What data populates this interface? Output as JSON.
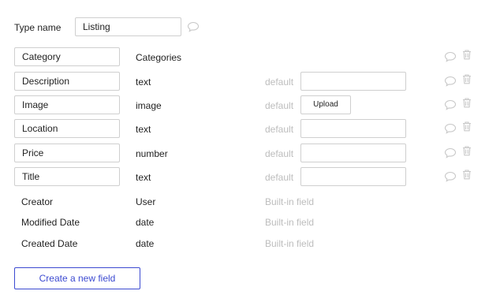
{
  "type_name": {
    "label": "Type name",
    "value": "Listing"
  },
  "fields": [
    {
      "name": "Category",
      "type": "Categories",
      "has_default": false
    },
    {
      "name": "Description",
      "type": "text",
      "has_default": true,
      "default_label": "default",
      "default_control": "input"
    },
    {
      "name": "Image",
      "type": "image",
      "has_default": true,
      "default_label": "default",
      "default_control": "upload",
      "upload_label": "Upload"
    },
    {
      "name": "Location",
      "type": "text",
      "has_default": true,
      "default_label": "default",
      "default_control": "input"
    },
    {
      "name": "Price",
      "type": "number",
      "has_default": true,
      "default_label": "default",
      "default_control": "input"
    },
    {
      "name": "Title",
      "type": "text",
      "has_default": true,
      "default_label": "default",
      "default_control": "input"
    }
  ],
  "builtin_fields": [
    {
      "name": "Creator",
      "type": "User",
      "note": "Built-in field"
    },
    {
      "name": "Modified Date",
      "type": "date",
      "note": "Built-in field"
    },
    {
      "name": "Created Date",
      "type": "date",
      "note": "Built-in field"
    }
  ],
  "create_button": {
    "label": "Create a new field"
  },
  "icons": {
    "comment": "comment-icon",
    "delete": "trash-icon"
  },
  "colors": {
    "accent": "#3c4ad1",
    "muted": "#bdbdbd",
    "border": "#cfcfcf",
    "icon": "#c8c8c8"
  }
}
